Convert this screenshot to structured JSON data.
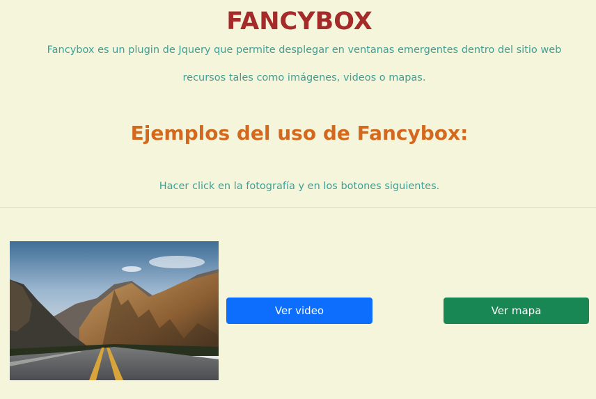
{
  "header": {
    "title": "FANCYBOX",
    "intro_line1": "Fancybox es un plugin de Jquery que permite desplegar en ventanas emergentes dentro del sitio web",
    "intro_line2": "recursos tales como imágenes, videos o mapas."
  },
  "examples": {
    "heading": "Ejemplos del uso de Fancybox:",
    "instruction": "Hacer click en la fotografía y en los botones siguientes."
  },
  "gallery": {
    "photo": "mountain-road-photo"
  },
  "buttons": {
    "video_label": "Ver video",
    "map_label": "Ver mapa"
  },
  "colors": {
    "background": "#f5f5dc",
    "title": "#a52a2a",
    "heading": "#d2691e",
    "text": "#3f9f94",
    "video_button": "#0d6efd",
    "map_button": "#198754"
  }
}
